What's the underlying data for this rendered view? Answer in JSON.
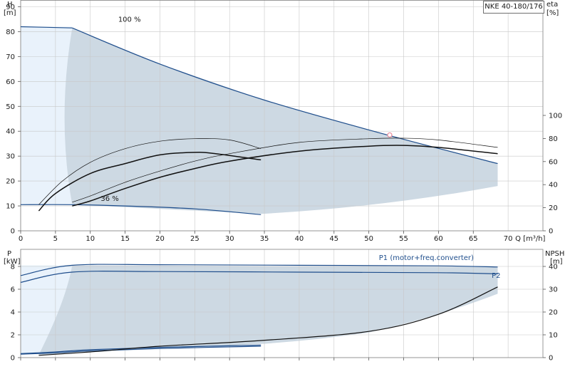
{
  "model_label": "NKE 40-180/176",
  "colors": {
    "region": "#cdd9e3",
    "region_light": "#e9f2fb",
    "curve_blue": "#1f4e8c",
    "curve_black": "#111111",
    "op_point": "#e88a9a"
  },
  "chart_data": [
    {
      "type": "line",
      "panel": "head",
      "grid": true,
      "x_axis": {
        "label": "Q [m³/h]",
        "label_left": "70",
        "ticks": [
          "0",
          "5",
          "10",
          "15",
          "20",
          "25",
          "30",
          "35",
          "40",
          "45",
          "50",
          "55",
          "60",
          "65"
        ],
        "range": [
          0,
          71
        ]
      },
      "y_axis_left": {
        "label_top": "H",
        "label_unit": "[m]",
        "ticks": [
          "0",
          "10",
          "20",
          "30",
          "40",
          "50",
          "60",
          "70",
          "80",
          "90"
        ],
        "range": [
          0,
          91
        ]
      },
      "y_axis_right": {
        "label_top": "eta",
        "label_unit": "[%]",
        "ticks": [
          "0",
          "20",
          "40",
          "60",
          "80",
          "100"
        ],
        "range": [
          0,
          100
        ]
      },
      "annotations": [
        {
          "text": "100 %",
          "x": 14,
          "y": 84
        },
        {
          "text": "36 %",
          "x": 11.5,
          "y": 12
        }
      ],
      "operating_point": {
        "x": 53,
        "y": 38.5
      },
      "series": [
        {
          "role": "H-curve-max",
          "x": [
            0,
            7.4,
            20,
            35,
            52,
            68.5
          ],
          "y": [
            82,
            81.5,
            67,
            52.5,
            39,
            27
          ]
        },
        {
          "role": "H-curve-min",
          "x": [
            0,
            7.4,
            15,
            25,
            34.5
          ],
          "y": [
            10.5,
            10.5,
            10,
            8.8,
            6.5
          ]
        },
        {
          "role": "eta-max",
          "x": [
            2.6,
            5,
            10,
            15,
            20,
            25,
            28,
            34.5
          ],
          "y": [
            8,
            15,
            23,
            27,
            30.5,
            31.5,
            31,
            28.5
          ]
        },
        {
          "role": "eta-min",
          "x": [
            7.4,
            10,
            15,
            20,
            25,
            30,
            40,
            50,
            55,
            60,
            68.5
          ],
          "y": [
            10,
            12,
            17,
            21.5,
            25,
            28,
            32,
            34,
            34.3,
            33.5,
            31
          ]
        },
        {
          "role": "eta-thin-1",
          "x": [
            2.6,
            6,
            10,
            15,
            20,
            25,
            30,
            34.5
          ],
          "y": [
            10.5,
            20,
            27.5,
            33,
            36,
            37,
            36.5,
            33
          ]
        },
        {
          "role": "eta-thin-2",
          "x": [
            7.4,
            10,
            15,
            20,
            25,
            30,
            40,
            50,
            55,
            60,
            68.5
          ],
          "y": [
            11.5,
            14,
            19.5,
            24,
            28,
            31,
            35.5,
            37,
            37.2,
            36.5,
            33.5
          ]
        }
      ]
    },
    {
      "type": "line",
      "panel": "power",
      "grid": true,
      "y_axis_left": {
        "label_top": "P",
        "label_unit": "[kW]",
        "ticks": [
          "0",
          "2",
          "4",
          "6",
          "8"
        ],
        "range": [
          0,
          9
        ]
      },
      "y_axis_right": {
        "label_top": "NPSH",
        "label_unit": "[m]",
        "ticks": [
          "0",
          "10",
          "20",
          "30",
          "40"
        ],
        "range": [
          0,
          45
        ]
      },
      "legend": [
        {
          "text": "P1 (motor+freq.converter)"
        },
        {
          "text": "P2"
        }
      ],
      "series": [
        {
          "role": "P1-max",
          "x": [
            0,
            7.4,
            20,
            40,
            60,
            68.5
          ],
          "y": [
            7.2,
            8.1,
            8.15,
            8.1,
            8.05,
            7.95
          ]
        },
        {
          "role": "P2-max",
          "x": [
            0,
            7.4,
            20,
            40,
            60,
            68.5
          ],
          "y": [
            6.6,
            7.5,
            7.55,
            7.5,
            7.45,
            7.35
          ]
        },
        {
          "role": "P1-min",
          "x": [
            0,
            5,
            10,
            20,
            34.5
          ],
          "y": [
            0.35,
            0.5,
            0.7,
            0.9,
            1.1
          ]
        },
        {
          "role": "P2-min",
          "x": [
            0,
            5,
            10,
            20,
            34.5
          ],
          "y": [
            0.3,
            0.42,
            0.6,
            0.8,
            1.0
          ]
        },
        {
          "role": "NPSH",
          "x": [
            2.6,
            10,
            20,
            34.5,
            50,
            60,
            68.5
          ],
          "y": [
            0.2,
            0.5,
            1.0,
            1.5,
            2.3,
            3.8,
            6.2
          ]
        }
      ]
    }
  ]
}
